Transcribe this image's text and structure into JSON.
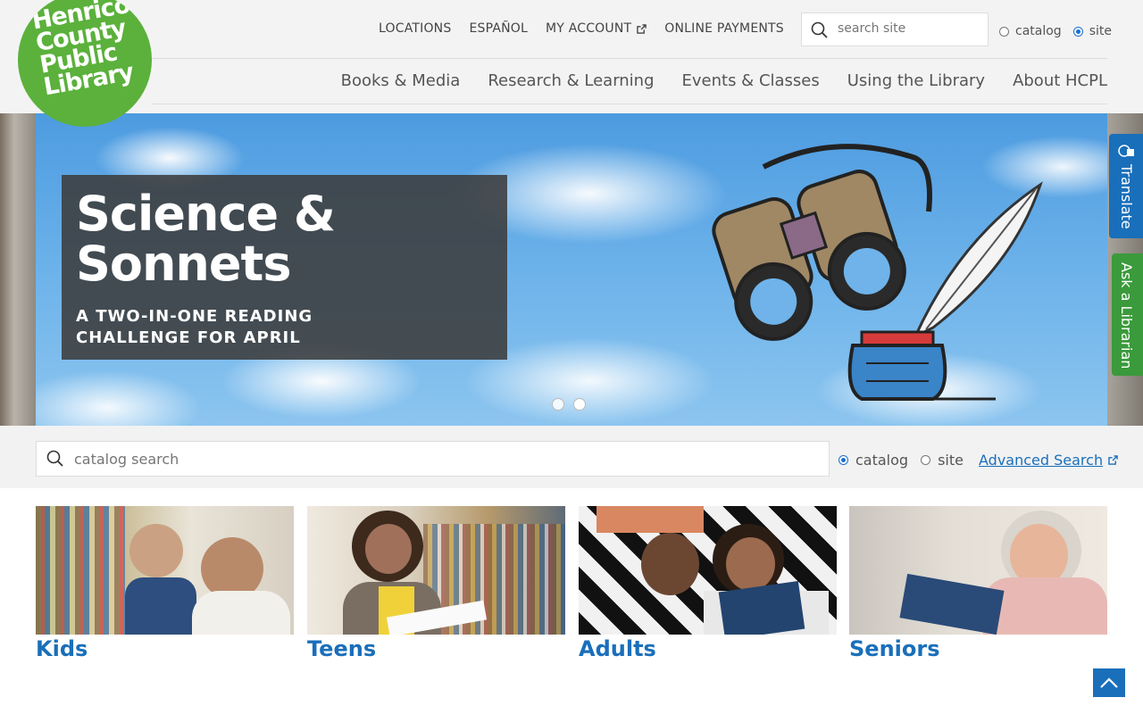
{
  "logo": {
    "lines": [
      "Henrico",
      "County",
      "Public",
      "Library"
    ]
  },
  "utility_nav": [
    {
      "label": "LOCATIONS",
      "external": false
    },
    {
      "label": "ESPAÑOL",
      "external": false
    },
    {
      "label": "MY ACCOUNT",
      "external": true
    },
    {
      "label": "ONLINE PAYMENTS",
      "external": false
    }
  ],
  "top_search": {
    "placeholder": "search site",
    "options": [
      "catalog",
      "site"
    ],
    "selected": "site"
  },
  "main_nav": [
    "Books & Media",
    "Research & Learning",
    "Events & Classes",
    "Using the Library",
    "About HCPL"
  ],
  "hero": {
    "title_line1": "Science &",
    "title_line2": "Sonnets",
    "subtitle_line1": "A TWO-IN-ONE READING",
    "subtitle_line2": "CHALLENGE FOR APRIL",
    "slide_count": 2,
    "active_slide": 1
  },
  "side_tabs": {
    "translate": "Translate",
    "ask": "Ask a Librarian"
  },
  "catalog_search": {
    "placeholder": "catalog search",
    "options": [
      "catalog",
      "site"
    ],
    "selected": "catalog",
    "advanced_label": "Advanced Search"
  },
  "audiences": [
    {
      "label": "Kids"
    },
    {
      "label": "Teens"
    },
    {
      "label": "Adults"
    },
    {
      "label": "Seniors"
    }
  ],
  "colors": {
    "brand_green": "#5bb13b",
    "link_blue": "#1a6fba",
    "ask_green": "#3b9a3b"
  },
  "icons": [
    "search-icon",
    "external-link-icon",
    "translate-icon",
    "chevron-up-icon"
  ]
}
